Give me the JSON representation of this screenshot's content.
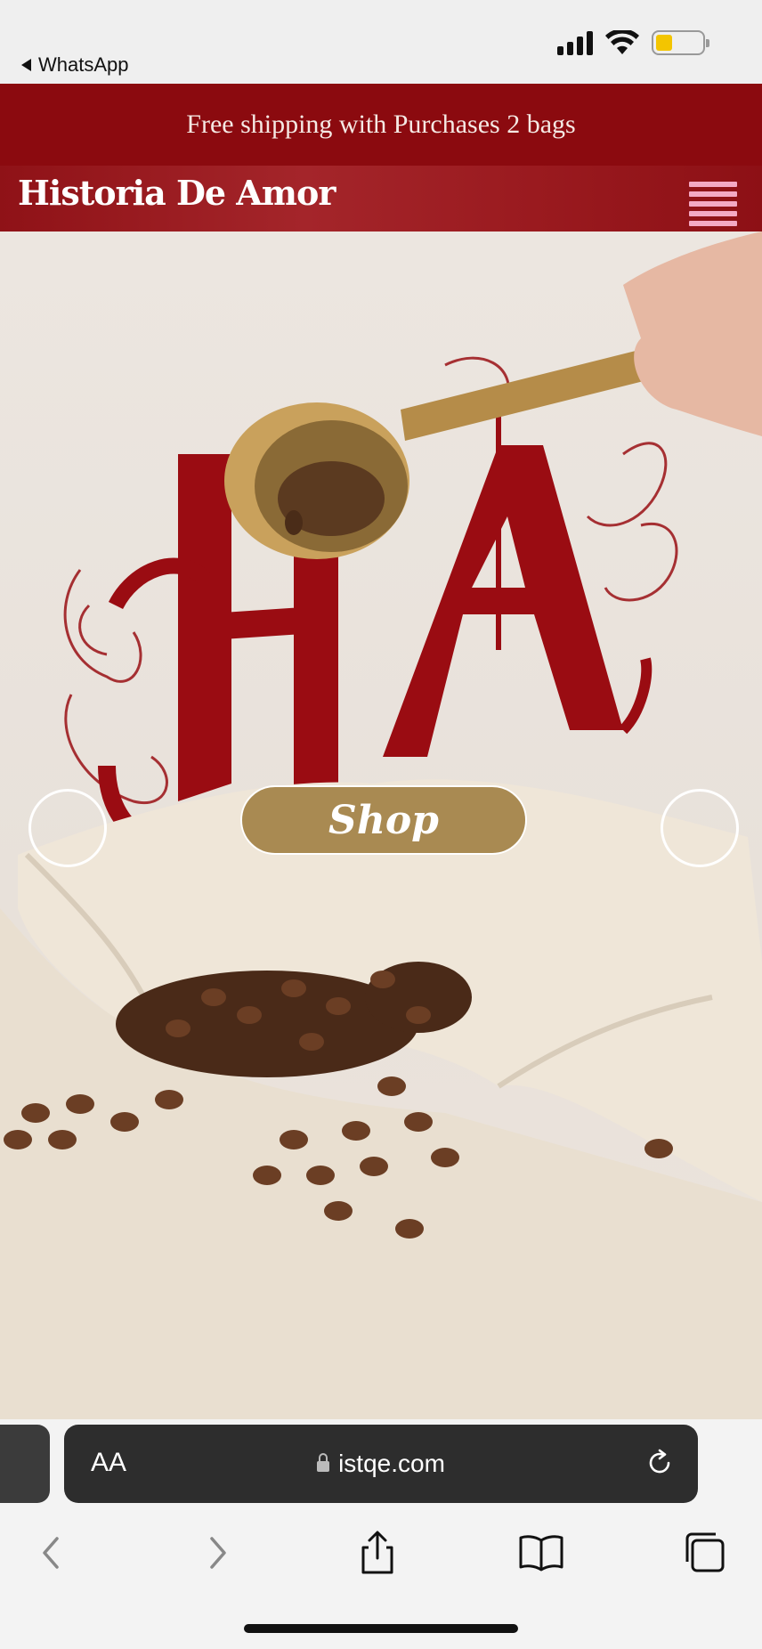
{
  "status_bar": {
    "back_app": "WhatsApp",
    "icons": [
      "signal-icon",
      "wifi-icon",
      "battery-icon"
    ]
  },
  "promo": {
    "text": "Free shipping with Purchases 2 bags"
  },
  "header": {
    "logo": "Historia De Amor",
    "menu_icon": "hamburger-icon"
  },
  "hero": {
    "shop_label": "Shop",
    "prev_icon": "carousel-prev-icon",
    "next_icon": "carousel-next-icon"
  },
  "browser": {
    "text_size_label": "AA",
    "url": "istqe.com",
    "toolbar": [
      "back-icon",
      "forward-icon",
      "share-icon",
      "bookmarks-icon",
      "tabs-icon"
    ]
  },
  "colors": {
    "brand_red": "#8b0a0f",
    "button_gold": "#a98a52",
    "menu_pink": "#f4a9c4"
  }
}
